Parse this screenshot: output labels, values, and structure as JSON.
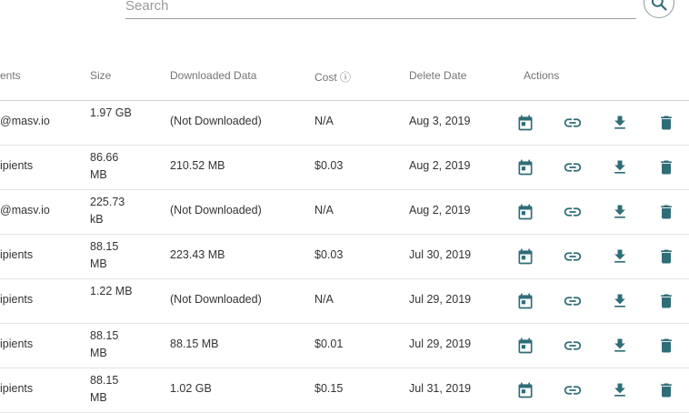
{
  "search": {
    "placeholder": "Search"
  },
  "table": {
    "columns": {
      "recipients": "ents",
      "size": "Size",
      "downloaded": "Downloaded Data",
      "cost": "Cost",
      "cost_info_icon": "info-icon",
      "delete_date": "Delete Date",
      "actions": "Actions"
    },
    "rows": [
      {
        "recipients": "@masv.io",
        "size": "1.97 GB",
        "downloaded": "(Not Downloaded)",
        "cost": "N/A",
        "delete_date": "Aug 3, 2019"
      },
      {
        "recipients": "ipients",
        "size": "86.66 MB",
        "downloaded": "210.52 MB",
        "cost": "$0.03",
        "delete_date": "Aug 2, 2019"
      },
      {
        "recipients": "@masv.io",
        "size": "225.73 kB",
        "downloaded": "(Not Downloaded)",
        "cost": "N/A",
        "delete_date": "Aug 2, 2019"
      },
      {
        "recipients": "ipients",
        "size": "88.15 MB",
        "downloaded": "223.43 MB",
        "cost": "$0.03",
        "delete_date": "Jul 30, 2019"
      },
      {
        "recipients": "ipients",
        "size": "1.22 MB",
        "downloaded": "(Not Downloaded)",
        "cost": "N/A",
        "delete_date": "Jul 29, 2019"
      },
      {
        "recipients": "ipients",
        "size": "88.15 MB",
        "downloaded": "88.15 MB",
        "cost": "$0.01",
        "delete_date": "Jul 29, 2019"
      },
      {
        "recipients": "ipients",
        "size": "88.15 MB",
        "downloaded": "1.02 GB",
        "cost": "$0.15",
        "delete_date": "Jul 31, 2019"
      }
    ],
    "action_icons": [
      "calendar-icon",
      "link-icon",
      "download-icon",
      "delete-icon"
    ]
  },
  "colors": {
    "accent": "#2f6d78",
    "header_text": "#757575",
    "text": "#333333",
    "divider": "#e4e4e4"
  }
}
